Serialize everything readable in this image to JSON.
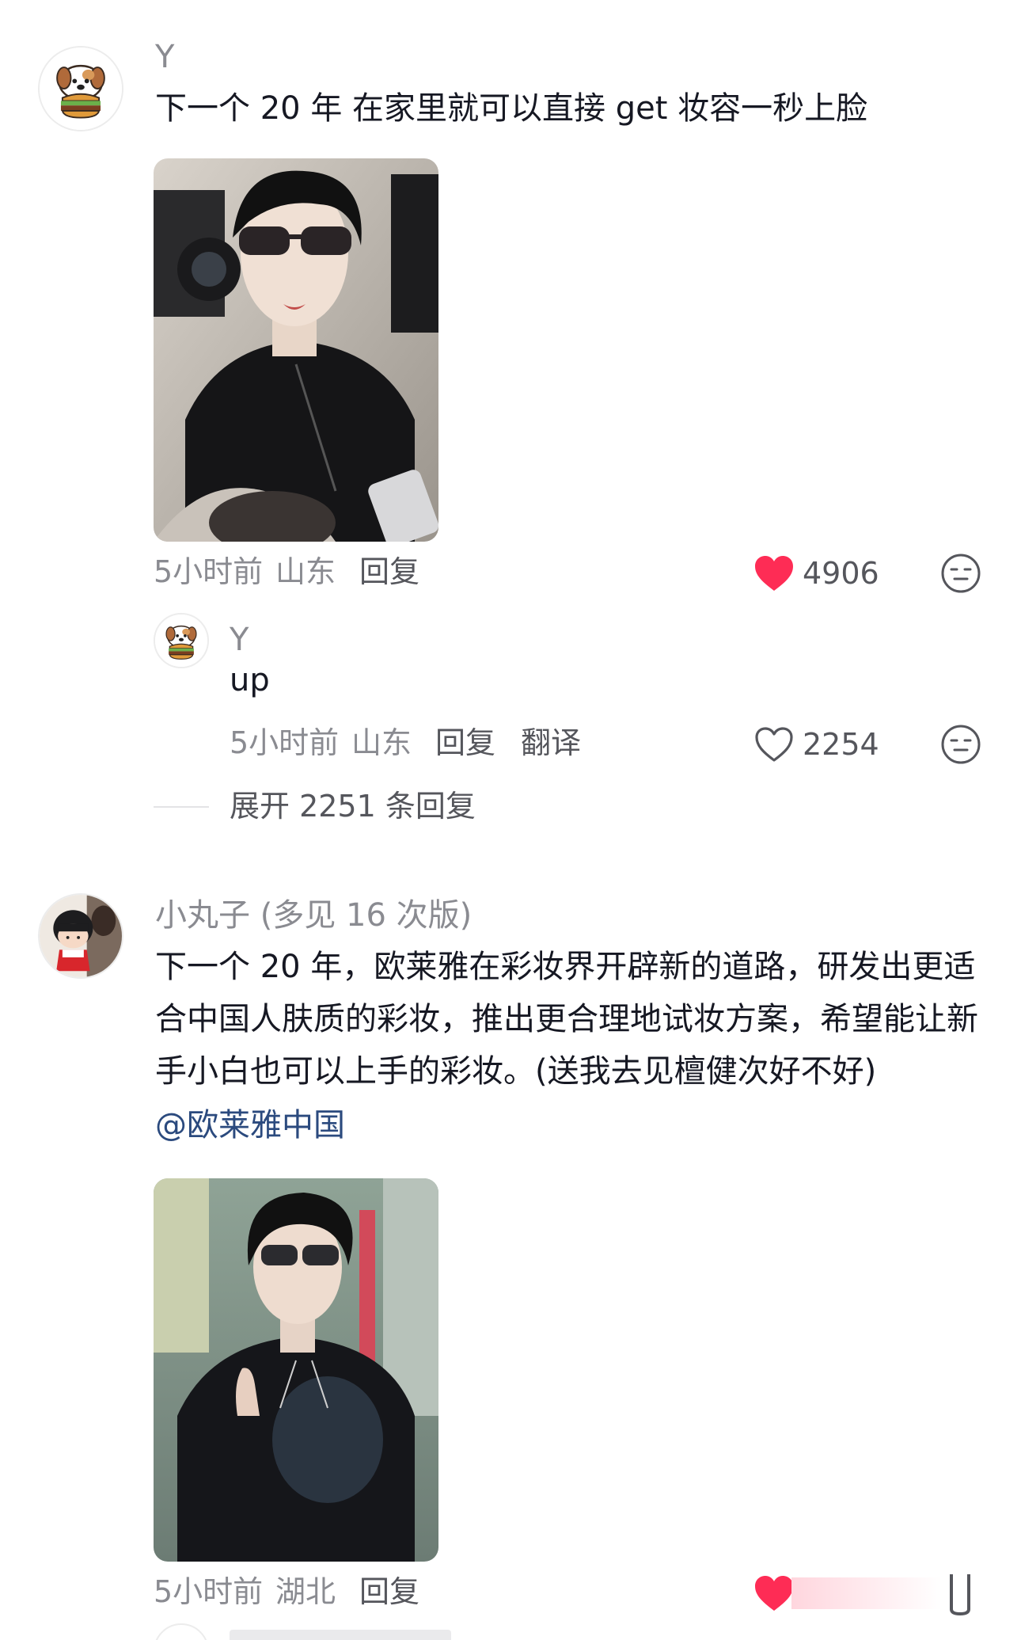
{
  "comments": [
    {
      "username": "Y",
      "text": "下一个 20 年 在家里就可以直接 get 妆容一秒上脸",
      "avatar_icon": "puppy-burger-icon",
      "image_desc": "man-sunglasses-black-jacket",
      "time": "5小时前",
      "location": "山东",
      "reply_label": "回复",
      "likes": "4906",
      "liked": true,
      "heart_color": "#fe2c55",
      "reaction_icon": "neutral-face-icon",
      "replies": [
        {
          "username": "Y",
          "text": "up",
          "avatar_icon": "puppy-burger-icon",
          "time": "5小时前",
          "location": "山东",
          "reply_label": "回复",
          "translate_label": "翻译",
          "likes": "2254",
          "liked": false,
          "reaction_icon": "neutral-face-icon"
        }
      ],
      "expand_label": "展开 2251 条回复"
    },
    {
      "username": "小丸子 (多见 16 次版)",
      "text": "下一个 20 年，欧莱雅在彩妆界开辟新的道路，研发出更适合中国人肤质的彩妆，推出更合理地试妆方案，希望能让新手小白也可以上手的彩妆。(送我去见檀健次好不好)",
      "mention": "@欧莱雅中国",
      "avatar_icon": "maruko-girl-icon",
      "image_desc": "man-sunglasses-black-sweater-waving",
      "time": "5小时前",
      "location": "湖北",
      "reply_label": "回复",
      "heart_color": "#fe2c55"
    }
  ]
}
